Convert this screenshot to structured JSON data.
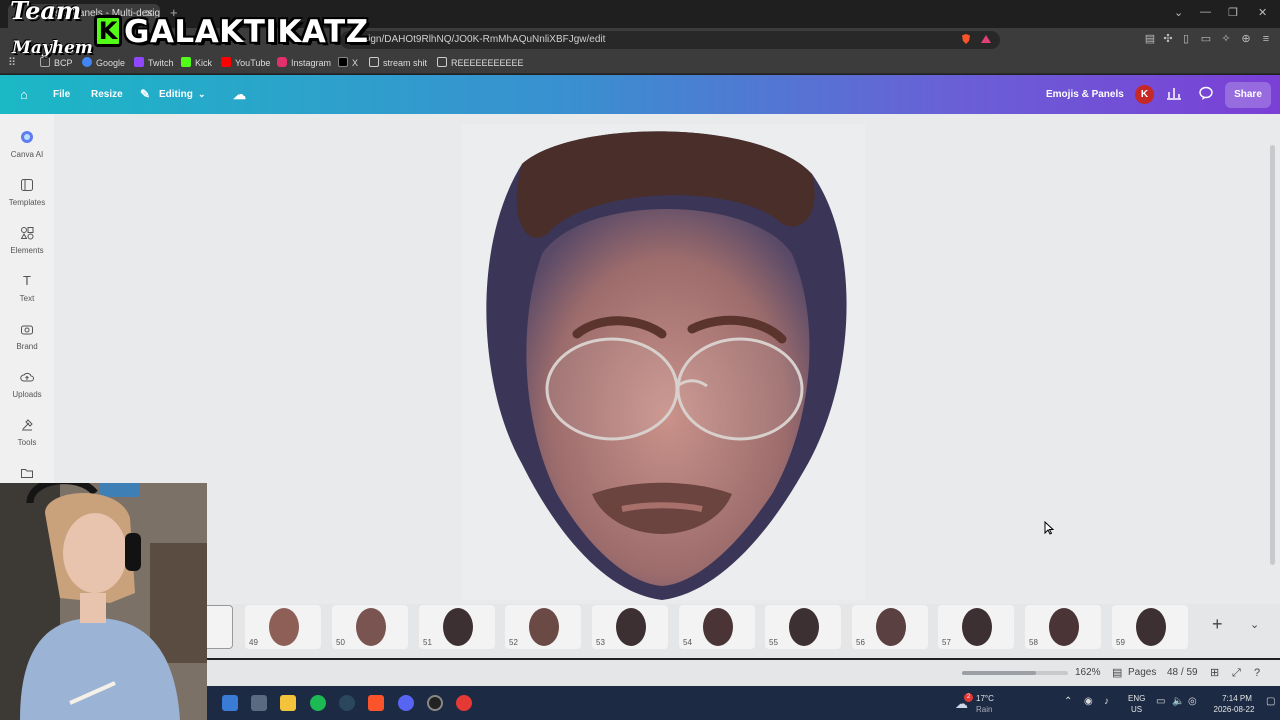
{
  "browser": {
    "tab_title": "Emojis & Panels - Multi-design",
    "tab_close": "✕",
    "new_tab": "+",
    "url": "design/DAHOt9RlhNQ/JO0K-RmMhAQuNnliXBFJgw/edit",
    "window_controls": [
      "⌄",
      "—",
      "❐",
      "✕"
    ]
  },
  "bookmarks": [
    {
      "label": "BCP",
      "color": "#4a4a4a"
    },
    {
      "label": "Google",
      "color": "#4285f4"
    },
    {
      "label": "Twitch",
      "color": "#9146ff"
    },
    {
      "label": "Kick",
      "color": "#53fc18"
    },
    {
      "label": "YouTube",
      "color": "#ff0000"
    },
    {
      "label": "Instagram",
      "color": "#e1306c"
    },
    {
      "label": "X",
      "color": "#000000"
    },
    {
      "label": "stream shit",
      "color": "#3c3c3c"
    },
    {
      "label": "REEEEEEEEEEE",
      "color": "#3c3c3c"
    }
  ],
  "header": {
    "file": "File",
    "resize": "Resize",
    "editing": "Editing",
    "project_title": "Emojis & Panels",
    "avatar_initial": "K",
    "share": "Share"
  },
  "sidebar": {
    "items": [
      {
        "label": "Canva AI",
        "icon": "canva-ai-icon"
      },
      {
        "label": "Templates",
        "icon": "templates-icon"
      },
      {
        "label": "Elements",
        "icon": "elements-icon"
      },
      {
        "label": "Text",
        "icon": "text-icon"
      },
      {
        "label": "Brand",
        "icon": "brand-icon"
      },
      {
        "label": "Uploads",
        "icon": "uploads-icon"
      },
      {
        "label": "Tools",
        "icon": "tools-icon"
      },
      {
        "label": "Projects",
        "icon": "projects-icon"
      }
    ]
  },
  "thumbnails": [
    "49",
    "50",
    "51",
    "52",
    "53",
    "54",
    "55",
    "56",
    "57",
    "58",
    "59"
  ],
  "status": {
    "zoom": "162%",
    "zoom_level": 0.7,
    "pages_label": "Pages",
    "page_counter": "48 / 59"
  },
  "taskbar": {
    "weather_temp": "17°C",
    "weather_desc": "Rain",
    "lang_top": "ENG",
    "lang_bottom": "US",
    "time": "7:14 PM",
    "date": "2026-08-22",
    "notification_count": "2"
  },
  "overlay": {
    "team": "Team",
    "mayhem": "Mayhem",
    "kick_letter": "K",
    "channel": "GALAKTIKATZ"
  },
  "colors": {
    "canva_gradient_start": "#1bb8c6",
    "canva_gradient_end": "#7b3fd6",
    "avatar_red": "#c62828",
    "kick_green": "#53fc18",
    "taskbar_bg": "#1d2a44"
  }
}
